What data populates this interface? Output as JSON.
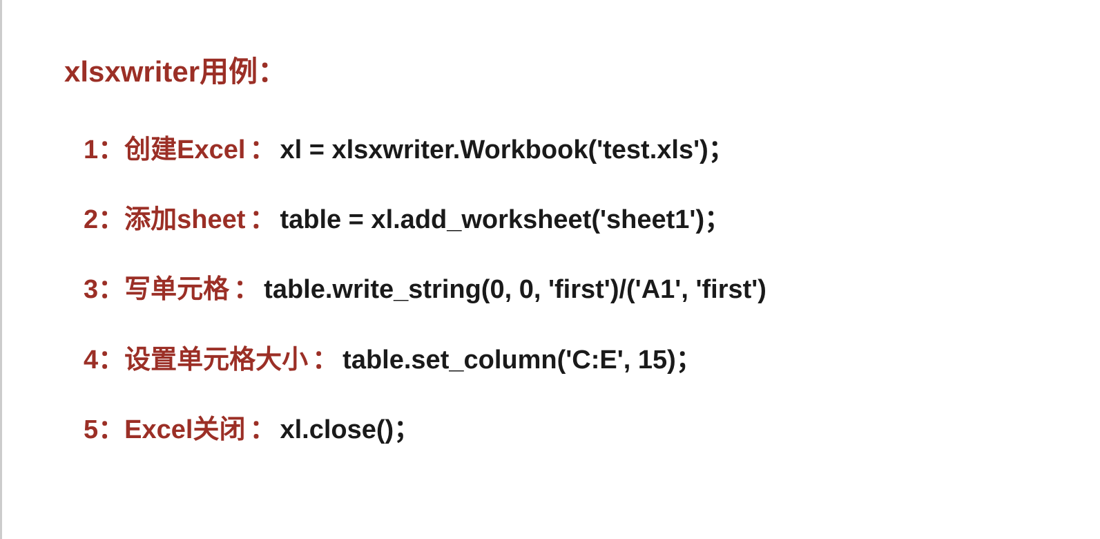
{
  "title": "xlsxwriter用例：",
  "items": [
    {
      "num": "1：",
      "label": "创建Excel",
      "code": "xl = xlsxwriter.Workbook('test.xls')；"
    },
    {
      "num": "2：",
      "label": "添加sheet",
      "code": "table = xl.add_worksheet('sheet1')；"
    },
    {
      "num": "3：",
      "label": "写单元格",
      "code": "table.write_string(0, 0, 'first')/('A1', 'first')"
    },
    {
      "num": "4：",
      "label": "设置单元格大小",
      "code": "table.set_column('C:E', 15)；"
    },
    {
      "num": "5：",
      "label": "Excel关闭",
      "code": "xl.close()；"
    }
  ]
}
